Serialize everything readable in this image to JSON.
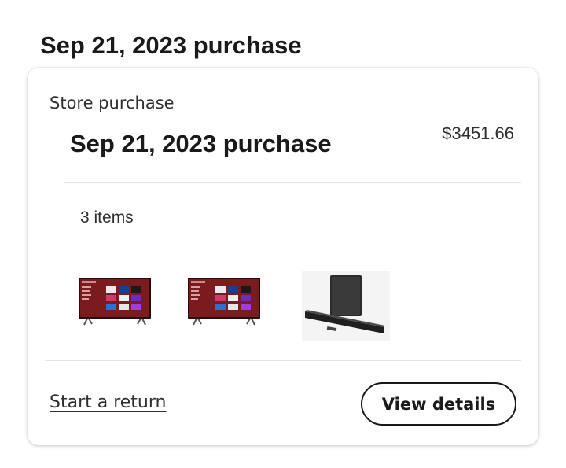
{
  "page": {
    "heading": "Sep 21, 2023 purchase"
  },
  "order": {
    "store_label": "Store purchase",
    "title": "Sep 21, 2023 purchase",
    "price": "$3451.66",
    "items_count": "3 items",
    "items": [
      {
        "kind": "television",
        "icon": "tv-thumbnail"
      },
      {
        "kind": "television",
        "icon": "tv-thumbnail"
      },
      {
        "kind": "soundbar",
        "icon": "soundbar-thumbnail"
      }
    ],
    "return_link": "Start a return",
    "details_button": "View details"
  },
  "colors": {
    "text_primary": "#1a1a1a",
    "text_secondary": "#2e2f32",
    "divider": "#e3e4e5",
    "tv_screen": "#7a1c1f"
  }
}
